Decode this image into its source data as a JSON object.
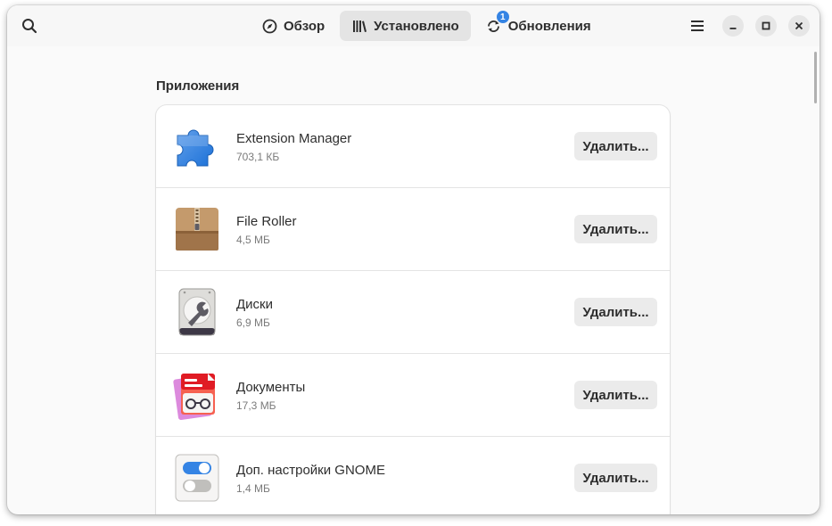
{
  "header": {
    "tabs": [
      {
        "label": "Обзор",
        "icon": "compass-icon",
        "active": false
      },
      {
        "label": "Установлено",
        "icon": "library-icon",
        "active": true
      },
      {
        "label": "Обновления",
        "icon": "refresh-icon",
        "active": false,
        "badge": "1"
      }
    ]
  },
  "main": {
    "section_title": "Приложения",
    "remove_label": "Удалить...",
    "apps": [
      {
        "name": "Extension Manager",
        "size": "703,1 КБ",
        "icon": "puzzle-icon"
      },
      {
        "name": "File Roller",
        "size": "4,5 МБ",
        "icon": "archive-box-icon"
      },
      {
        "name": "Диски",
        "size": "6,9 МБ",
        "icon": "disk-utility-icon"
      },
      {
        "name": "Документы",
        "size": "17,3 МБ",
        "icon": "documents-icon"
      },
      {
        "name": "Доп. настройки GNOME",
        "size": "1,4 МБ",
        "icon": "tweaks-toggle-icon"
      }
    ]
  },
  "colors": {
    "accent": "#3584e4",
    "active_tab": "#e4e4e4"
  }
}
